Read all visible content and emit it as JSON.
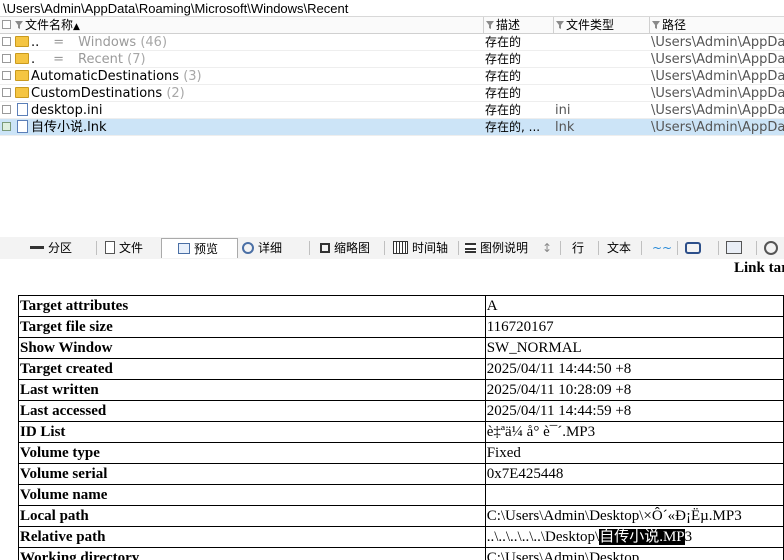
{
  "path_bar": {
    "text": "\\Users\\Admin\\AppData\\Roaming\\Microsoft\\Windows\\Recent"
  },
  "columns": {
    "name": "文件名称",
    "sort_arrow": "▲",
    "description": "描述",
    "file_type": "文件类型",
    "path": "路径"
  },
  "rows": [
    {
      "icon": "folder-icon",
      "name": "..",
      "label": "=",
      "label2": "Windows",
      "count": "(46)",
      "desc": "存在的",
      "type": "",
      "path": "\\Users\\Admin\\AppData",
      "grey": true
    },
    {
      "icon": "folder-icon",
      "name": ".",
      "label": "=",
      "label2": "Recent",
      "count": "(7)",
      "desc": "存在的",
      "type": "",
      "path": "\\Users\\Admin\\AppData",
      "grey": true
    },
    {
      "icon": "folder-icon",
      "name": "AutomaticDestinations",
      "count": "(3)",
      "desc": "存在的",
      "type": "",
      "path": "\\Users\\Admin\\AppData"
    },
    {
      "icon": "folder-icon",
      "name": "CustomDestinations",
      "count": "(2)",
      "desc": "存在的",
      "type": "",
      "path": "\\Users\\Admin\\AppData"
    },
    {
      "icon": "document-icon",
      "name": "desktop.ini",
      "count": "",
      "desc": "存在的",
      "type": "ini",
      "path": "\\Users\\Admin\\AppData"
    },
    {
      "icon": "document-icon",
      "name": "自传小说.lnk",
      "count": "",
      "desc": "存在的, ...",
      "type": "lnk",
      "path": "\\Users\\Admin\\AppData",
      "selected": true
    }
  ],
  "toolbar": {
    "partition": "分区",
    "file": "文件",
    "preview": "预览",
    "details": "详细",
    "thumbnail": "缩略图",
    "timeline": "时间轴",
    "legend": "图例说明",
    "row": "行",
    "text": "文本"
  },
  "report": {
    "title": "Link tar",
    "props": [
      {
        "key": "Target attributes",
        "value": "A"
      },
      {
        "key": "Target file size",
        "value": "116720167"
      },
      {
        "key": "Show Window",
        "value": "SW_NORMAL"
      },
      {
        "key": "Target created",
        "value": "2025/04/11 14:44:50 +8"
      },
      {
        "key": "Last written",
        "value": "2025/04/11 10:28:09 +8"
      },
      {
        "key": "Last accessed",
        "value": "2025/04/11 14:44:59 +8"
      },
      {
        "key": "ID List",
        "value": "è‡ªä¼ å° è¯´.MP3"
      },
      {
        "key": "Volume type",
        "value": "Fixed"
      },
      {
        "key": "Volume serial",
        "value": "0x7E425448"
      },
      {
        "key": "Volume name",
        "value": ""
      },
      {
        "key": "Local path",
        "value": "C:\\Users\\Admin\\Desktop\\×Ô´«Ð¡Ëµ.MP3"
      },
      {
        "key": "Relative path",
        "value_prefix": "..\\..\\..\\..\\..\\Desktop\\",
        "value_highlight": "自传小说.MP",
        "value_suffix": "3"
      },
      {
        "key": "Working directory",
        "value": "C:\\Users\\Admin\\Desktop"
      }
    ]
  }
}
